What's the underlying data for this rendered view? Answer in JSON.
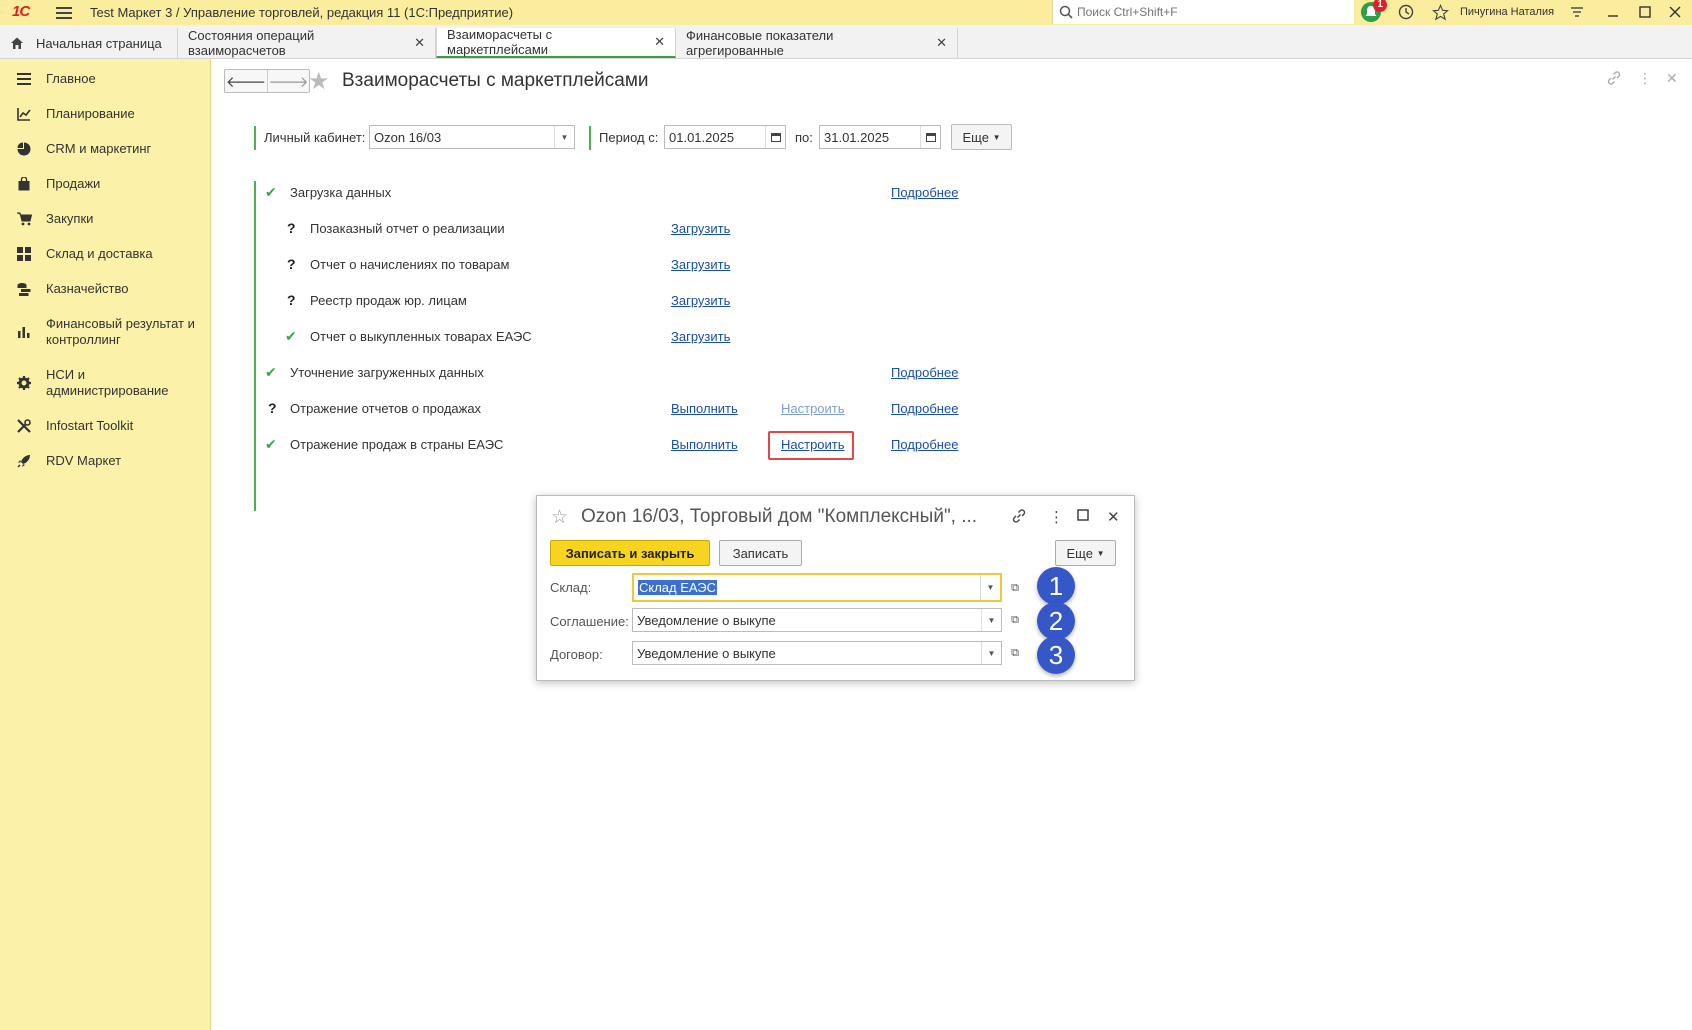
{
  "app": {
    "logo": "1С",
    "title": "Test Маркет 3 / Управление торговлей, редакция 11  (1С:Предприятие)",
    "search_placeholder": "Поиск Ctrl+Shift+F",
    "notifications_count": "1",
    "user_name": "Пичугина Наталия"
  },
  "tabs": [
    {
      "label": "Начальная страница"
    },
    {
      "label": "Состояния операций взаиморасчетов"
    },
    {
      "label": "Взаиморасчеты с маркетплейсами"
    },
    {
      "label": "Финансовые показатели агрегированные"
    }
  ],
  "sidebar": {
    "items": [
      {
        "label": "Главное",
        "icon": "menu-icon"
      },
      {
        "label": "Планирование",
        "icon": "chart-icon"
      },
      {
        "label": "CRM и маркетинг",
        "icon": "pie-icon"
      },
      {
        "label": "Продажи",
        "icon": "bag-icon"
      },
      {
        "label": "Закупки",
        "icon": "cart-icon"
      },
      {
        "label": "Склад и доставка",
        "icon": "grid-icon"
      },
      {
        "label": "Казначейство",
        "icon": "coins-icon"
      },
      {
        "label": "Финансовый результат и контроллинг",
        "icon": "bars-icon"
      },
      {
        "label": "НСИ и администрирование",
        "icon": "gear-icon"
      },
      {
        "label": "Infostart Toolkit",
        "icon": "tools-icon"
      },
      {
        "label": "RDV Маркет",
        "icon": "rocket-icon"
      }
    ]
  },
  "page": {
    "title": "Взаиморасчеты с маркетплейсами",
    "filters": {
      "cabinet_label": "Личный кабинет:",
      "cabinet_value": "Ozon 16/03",
      "period_label": "Период с:",
      "period_from": "01.01.2025",
      "period_to_label": "по:",
      "period_to": "31.01.2025",
      "more_label": "Еще"
    },
    "steps": [
      {
        "status": "check",
        "label": "Загрузка данных",
        "details": "Подробнее"
      },
      {
        "status": "question",
        "label": "Позаказный отчет о реализации",
        "action": "Загрузить"
      },
      {
        "status": "question",
        "label": "Отчет о начислениях по товарам",
        "action": "Загрузить"
      },
      {
        "status": "question",
        "label": "Реестр продаж юр. лицам",
        "action": "Загрузить"
      },
      {
        "status": "check",
        "label": "Отчет о выкупленных товарах ЕАЭС",
        "action": "Загрузить"
      },
      {
        "status": "check",
        "label": "Уточнение загруженных данных",
        "details": "Подробнее"
      },
      {
        "status": "question",
        "label": "Отражение отчетов о продажах",
        "action": "Выполнить",
        "configure": "Настроить",
        "details": "Подробнее"
      },
      {
        "status": "check",
        "label": "Отражение продаж в страны ЕАЭС",
        "action": "Выполнить",
        "configure": "Настроить",
        "details": "Подробнее"
      }
    ]
  },
  "dialog": {
    "title": "Ozon 16/03, Торговый дом \"Комплексный\", ...",
    "save_close": "Записать и закрыть",
    "save": "Записать",
    "more": "Еще",
    "fields": [
      {
        "label": "Склад:",
        "value": "Склад ЕАЭС",
        "marker": "1"
      },
      {
        "label": "Соглашение:",
        "value": "Уведомление о выкупе",
        "marker": "2"
      },
      {
        "label": "Договор:",
        "value": "Уведомление о выкупе",
        "marker": "3"
      }
    ]
  }
}
